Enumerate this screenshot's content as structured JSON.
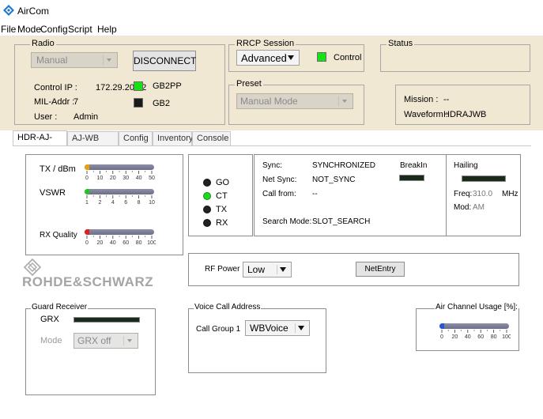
{
  "window": {
    "title": "AirCom"
  },
  "menu": [
    "File",
    "Mode",
    "Config",
    "Script",
    "Help"
  ],
  "radio": {
    "group": "Radio",
    "mode_value": "Manual",
    "disconnect_label": "DISCONNECT",
    "control_ip_label": "Control IP :",
    "control_ip": "172.29.20.32",
    "mil_addr_label": "MIL-Addr :",
    "mil_addr": "7",
    "user_label": "User :",
    "user": "Admin",
    "led1_label": "GB2PP",
    "led2_label": "GB2"
  },
  "rrcp": {
    "group": "RRCP Session",
    "mode_value": "Advanced",
    "control_label": "Control"
  },
  "preset": {
    "group": "Preset",
    "value": "Manual Mode"
  },
  "status": {
    "group": "Status",
    "mission_label": "Mission :",
    "mission": "--",
    "waveform_label": "Waveform :",
    "waveform": "HDRAJWB"
  },
  "tabs": [
    "HDR-AJ-WB",
    "AJ-WB CFG",
    "Config",
    "Inventory",
    "Console"
  ],
  "meters": {
    "tx_label": "TX / dBm",
    "tx_ticks": [
      "0",
      "10",
      "20",
      "30",
      "40",
      "50"
    ],
    "tx_level": 0.04,
    "vswr_label": "VSWR",
    "vswr_ticks": [
      "1",
      "2",
      "4",
      "6",
      "8",
      "10"
    ],
    "vswr_level": 0.04,
    "rxq_label": "RX Quality",
    "rxq_ticks": [
      "0",
      "20",
      "40",
      "60",
      "80",
      "100"
    ],
    "rxq_level": 0.04
  },
  "indicators": {
    "go": "GO",
    "ct": "CT",
    "tx": "TX",
    "rx": "RX"
  },
  "sync": {
    "sync_label": "Sync:",
    "sync": "SYNCHRONIZED",
    "net_sync_label": "Net Sync:",
    "net_sync": "NOT_SYNC",
    "call_from_label": "Call from:",
    "call_from": "--",
    "search_mode_label": "Search Mode:",
    "search_mode": "SLOT_SEARCH",
    "break_in_label": "BreakIn"
  },
  "hailing": {
    "label": "Hailing",
    "freq_label": "Freq:",
    "freq": "310.0",
    "freq_unit": "MHz",
    "mod_label": "Mod:",
    "mod": "AM"
  },
  "brand": {
    "name": "ROHDE&SCHWARZ"
  },
  "rf": {
    "label": "RF Power",
    "value": "Low",
    "netentry_label": "NetEntry"
  },
  "guard": {
    "group": "Guard Receiver",
    "grx_label": "GRX",
    "mode_label": "Mode",
    "mode_value": "GRX off"
  },
  "voice": {
    "group": "Voice Call Address",
    "call_group_label": "Call Group 1",
    "value": "WBVoice"
  },
  "air": {
    "group": "Air Channel Usage [%]:",
    "ticks": [
      "0",
      "20",
      "40",
      "60",
      "80",
      "100"
    ],
    "level": 0.04
  },
  "colors": {
    "accent": "#14e214",
    "panel_bg": "#f0e8d3",
    "bar": "#7a7c95",
    "tx_fill": "#e8a10f",
    "vswr_fill": "#22c322",
    "rxq_fill": "#e02020",
    "air_fill": "#2a55d6"
  }
}
